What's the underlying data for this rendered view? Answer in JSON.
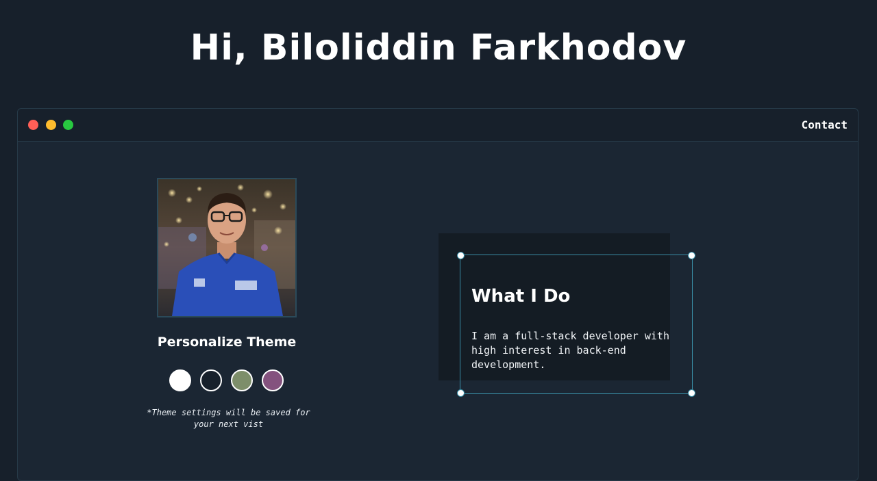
{
  "header": {
    "greeting": "Hi, Biloliddin Farkhodov"
  },
  "window": {
    "controls": {
      "close_color": "#ff5f57",
      "minimize_color": "#febc2e",
      "maximize_color": "#28c840"
    },
    "nav": {
      "contact_label": "Contact"
    }
  },
  "profile": {
    "photo_icon": "profile-photo",
    "theme": {
      "title": "Personalize Theme",
      "swatches": [
        {
          "name": "light",
          "color": "#ffffff"
        },
        {
          "name": "dark",
          "color": "#17202b"
        },
        {
          "name": "green",
          "color": "#7d8e6a"
        },
        {
          "name": "purple",
          "color": "#84527e"
        }
      ],
      "note": "*Theme settings will be saved for your next vist"
    }
  },
  "about": {
    "title": "What I Do",
    "text": "I am a full-stack developer with high interest in back-end development."
  }
}
